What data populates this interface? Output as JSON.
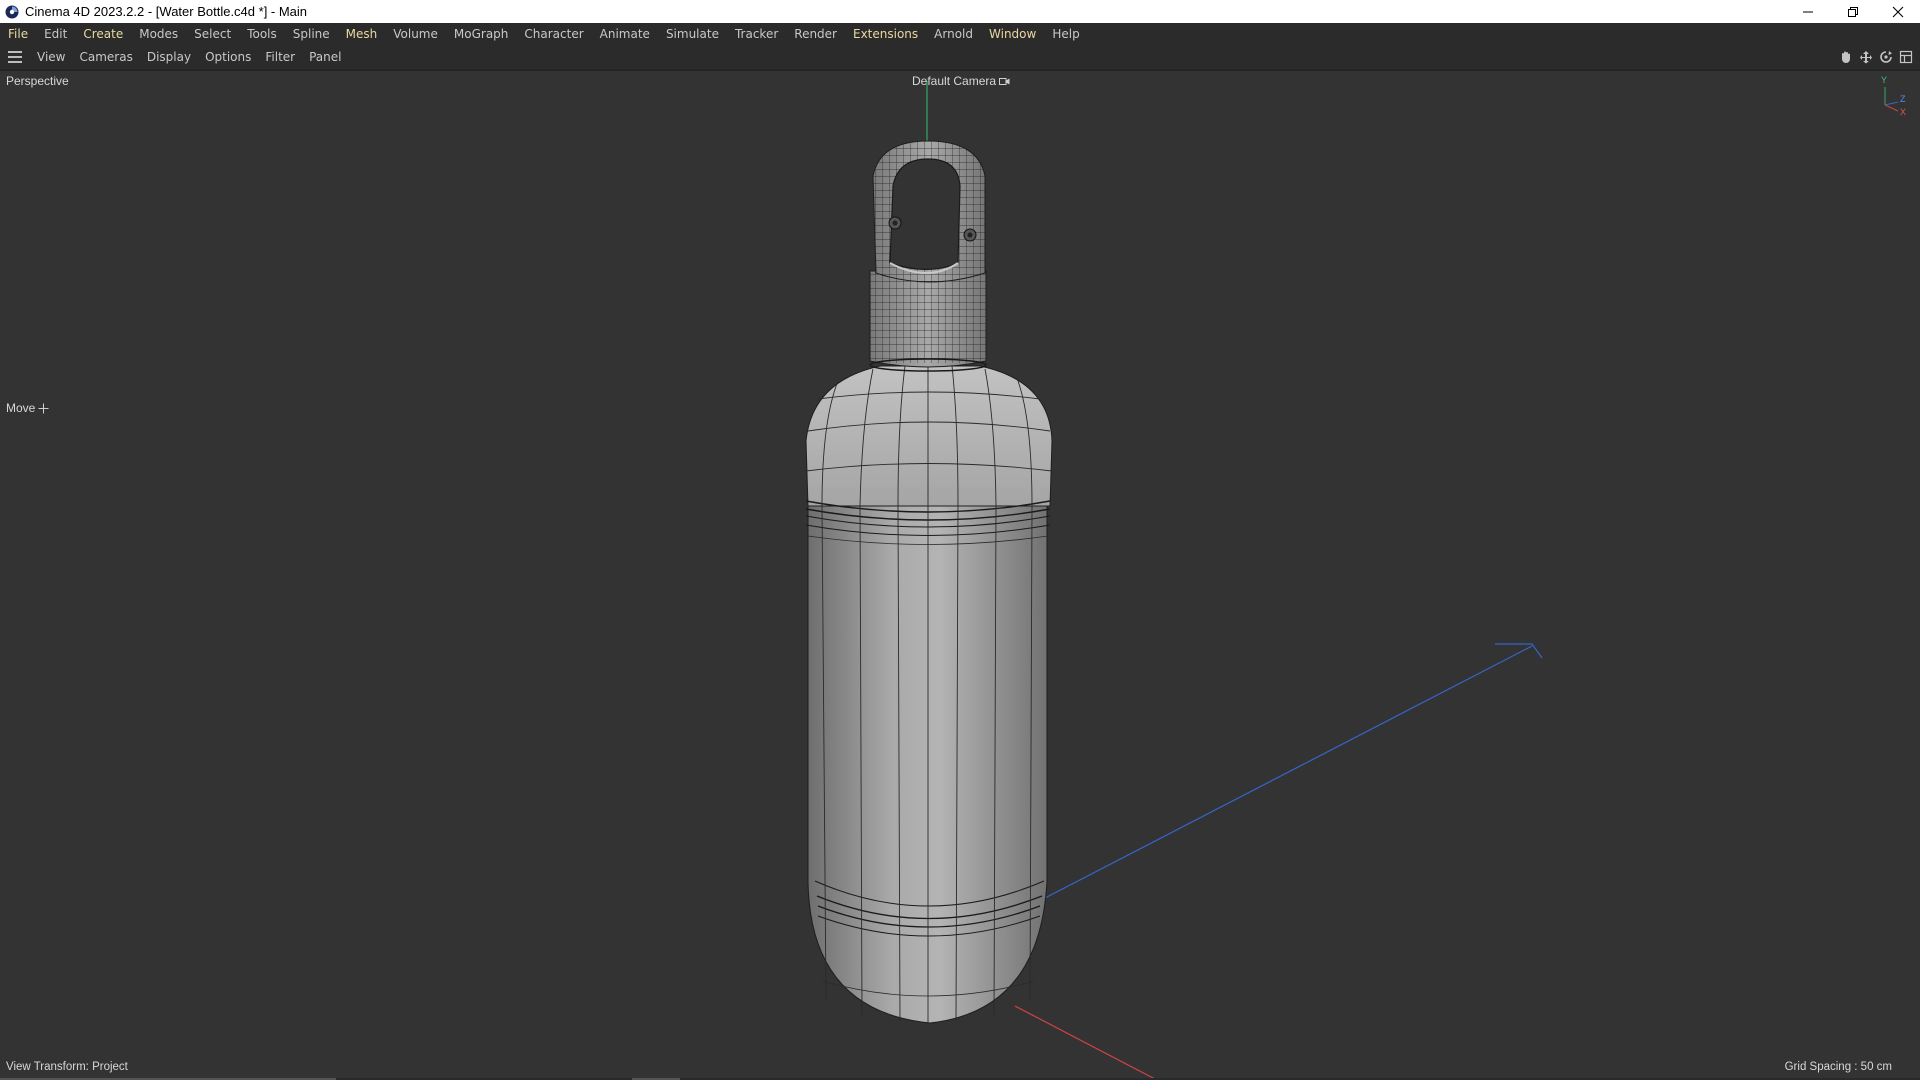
{
  "window": {
    "title": "Cinema 4D 2023.2.2 - [Water Bottle.c4d *] - Main"
  },
  "menu": [
    {
      "label": "File",
      "hl": true
    },
    {
      "label": "Edit",
      "hl": false
    },
    {
      "label": "Create",
      "hl": true
    },
    {
      "label": "Modes",
      "hl": false
    },
    {
      "label": "Select",
      "hl": false
    },
    {
      "label": "Tools",
      "hl": false
    },
    {
      "label": "Spline",
      "hl": false
    },
    {
      "label": "Mesh",
      "hl": true
    },
    {
      "label": "Volume",
      "hl": false
    },
    {
      "label": "MoGraph",
      "hl": false
    },
    {
      "label": "Character",
      "hl": false
    },
    {
      "label": "Animate",
      "hl": false
    },
    {
      "label": "Simulate",
      "hl": false
    },
    {
      "label": "Tracker",
      "hl": false
    },
    {
      "label": "Render",
      "hl": false
    },
    {
      "label": "Extensions",
      "hl": true
    },
    {
      "label": "Arnold",
      "hl": false
    },
    {
      "label": "Window",
      "hl": true
    },
    {
      "label": "Help",
      "hl": false
    }
  ],
  "viewport_menu": [
    "View",
    "Cameras",
    "Display",
    "Options",
    "Filter",
    "Panel"
  ],
  "viewport": {
    "projection": "Perspective",
    "camera": "Default Camera",
    "tool": "Move",
    "view_transform": "View Transform: Project",
    "grid_spacing": "Grid Spacing : 50 cm",
    "axis_y": "Y",
    "axis_z": "Z",
    "axis_x": "X"
  },
  "colors": {
    "menu_highlight": "#e8d9a0",
    "viewport_bg": "#333333",
    "axis_x": "#d94a4a",
    "axis_y": "#3fbf7f",
    "axis_z": "#3a6fd8"
  },
  "icons": {
    "app": "cinema4d-logo-icon",
    "minimize": "minimize-icon",
    "restore": "restore-icon",
    "close": "close-icon",
    "nav_pan": "hand-pan-icon",
    "nav_move": "move-arrows-icon",
    "nav_rotate": "rotate-icon",
    "nav_maximize": "maximize-panel-icon"
  }
}
